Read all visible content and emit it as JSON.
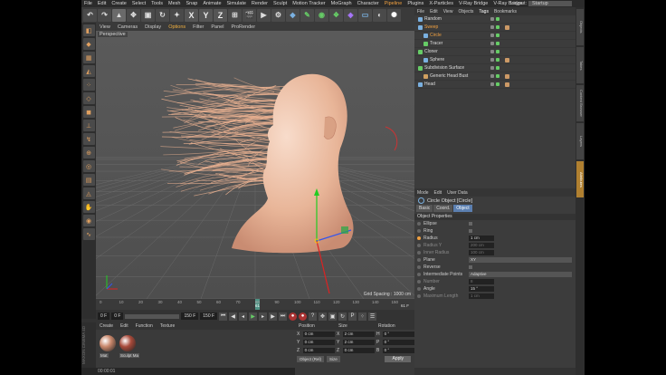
{
  "menubar": {
    "items": [
      "File",
      "Edit",
      "Create",
      "Select",
      "Tools",
      "Mesh",
      "Snap",
      "Animate",
      "Simulate",
      "Render",
      "Sculpt",
      "Motion Tracker",
      "MoGraph",
      "Character",
      "Pipeline",
      "Plugins",
      "X-Particles",
      "V-Ray Bridge",
      "V-Ray Bridge"
    ],
    "layout_label": "Layout:",
    "layout_value": "Startup"
  },
  "toolbar": {
    "x": "X",
    "y": "Y",
    "z": "Z"
  },
  "viewport": {
    "menu": [
      "View",
      "Cameras",
      "Display",
      "Options",
      "Filter",
      "Panel",
      "ProRender"
    ],
    "active_menu": "Options",
    "label": "Perspective",
    "grid_spacing": "Grid Spacing : 1000 cm"
  },
  "timeline": {
    "ticks": [
      "0",
      "10",
      "20",
      "30",
      "40",
      "50",
      "60",
      "70",
      "80",
      "90",
      "100",
      "110",
      "120",
      "130",
      "140",
      "150"
    ],
    "current_frame_marker": "61",
    "end_marker": "61 F",
    "start_field": "0 F",
    "min_field": "0 F",
    "max_field": "150 F",
    "end_field": "150 F"
  },
  "material_manager": {
    "menu": [
      "Create",
      "Edit",
      "Function",
      "Texture"
    ],
    "materials": [
      {
        "name": "Mat",
        "color": "#c8866a"
      },
      {
        "name": "Sculpt Ma",
        "color": "#a84a3a"
      }
    ]
  },
  "coordinates": {
    "headers": [
      "Position",
      "Size",
      "Rotation"
    ],
    "rows": [
      {
        "axis": "X",
        "pos": "0 cm",
        "size_axis": "X",
        "size": "2 cm",
        "rot_axis": "H",
        "rot": "0 °"
      },
      {
        "axis": "Y",
        "pos": "0 cm",
        "size_axis": "Y",
        "size": "2 cm",
        "rot_axis": "P",
        "rot": "0 °"
      },
      {
        "axis": "Z",
        "pos": "0 cm",
        "size_axis": "Z",
        "size": "0 cm",
        "rot_axis": "B",
        "rot": "0 °"
      }
    ],
    "mode": "Object (Rel)",
    "size_mode": "Size",
    "apply": "Apply"
  },
  "statusbar": {
    "time": "00:00:01"
  },
  "logo": {
    "text": "MAXON CINEMA 4D"
  },
  "object_manager": {
    "menu": [
      "File",
      "Edit",
      "View",
      "Objects",
      "Tags",
      "Bookmarks"
    ],
    "active_menu": "Tags",
    "objects": [
      {
        "name": "Random",
        "indent": 0,
        "selected": false,
        "color": "#7ab0e0"
      },
      {
        "name": "Sweep",
        "indent": 0,
        "selected": true,
        "color": "#7ab0e0"
      },
      {
        "name": "Circle",
        "indent": 1,
        "selected": true,
        "color": "#7ab0e0"
      },
      {
        "name": "Tracer",
        "indent": 1,
        "selected": false,
        "color": "#6c6"
      },
      {
        "name": "Cloner",
        "indent": 0,
        "selected": false,
        "color": "#6c6"
      },
      {
        "name": "Sphere",
        "indent": 1,
        "selected": false,
        "color": "#7ab0e0"
      },
      {
        "name": "Subdivision Surface",
        "indent": 0,
        "selected": false,
        "color": "#6c6"
      },
      {
        "name": "Generic Head Bust",
        "indent": 1,
        "selected": false,
        "color": "#d0a060"
      },
      {
        "name": "Head",
        "indent": 0,
        "selected": false,
        "color": "#7ab0e0"
      }
    ]
  },
  "attributes": {
    "menu": [
      "Mode",
      "Edit",
      "User Data"
    ],
    "title": "Circle Object [Circle]",
    "tabs": [
      "Basic",
      "Coord.",
      "Object"
    ],
    "active_tab": "Object",
    "section": "Object Properties",
    "rows": [
      {
        "label": "Ellipse",
        "type": "check",
        "dim": false
      },
      {
        "label": "Ring",
        "type": "check",
        "dim": false
      },
      {
        "label": "Radius",
        "type": "value",
        "value": "1 cm",
        "dim": false,
        "accent": true
      },
      {
        "label": "Radius Y",
        "type": "value",
        "value": "200 cm",
        "dim": true
      },
      {
        "label": "Inner Radius",
        "type": "value",
        "value": "100 cm",
        "dim": true
      },
      {
        "label": "Plane",
        "type": "dropdown",
        "value": "XY",
        "dim": false
      },
      {
        "label": "Reverse",
        "type": "check",
        "dim": false
      },
      {
        "label": "Intermediate Points",
        "type": "dropdown",
        "value": "Adaptive",
        "dim": false
      },
      {
        "label": "Number",
        "type": "value",
        "value": "8",
        "dim": true
      },
      {
        "label": "Angle",
        "type": "value",
        "value": "15 °",
        "dim": false
      },
      {
        "label": "Maximum Length",
        "type": "value",
        "value": "1 cm",
        "dim": true
      }
    ]
  },
  "side_tabs": [
    "Objects",
    "Takes",
    "Content Browser",
    "Layers",
    "Attributes"
  ],
  "colors": {
    "accent": "#f0a040",
    "hair": "#e8b090",
    "skin": "#f2c9b0"
  }
}
